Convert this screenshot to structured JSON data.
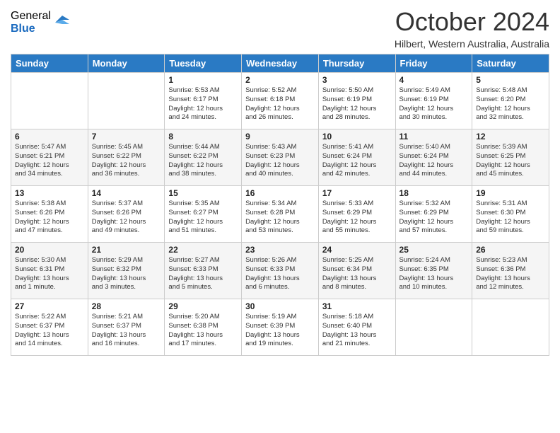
{
  "logo": {
    "general": "General",
    "blue": "Blue"
  },
  "title": "October 2024",
  "location": "Hilbert, Western Australia, Australia",
  "days_header": [
    "Sunday",
    "Monday",
    "Tuesday",
    "Wednesday",
    "Thursday",
    "Friday",
    "Saturday"
  ],
  "weeks": [
    [
      {
        "day": "",
        "info": ""
      },
      {
        "day": "",
        "info": ""
      },
      {
        "day": "1",
        "info": "Sunrise: 5:53 AM\nSunset: 6:17 PM\nDaylight: 12 hours\nand 24 minutes."
      },
      {
        "day": "2",
        "info": "Sunrise: 5:52 AM\nSunset: 6:18 PM\nDaylight: 12 hours\nand 26 minutes."
      },
      {
        "day": "3",
        "info": "Sunrise: 5:50 AM\nSunset: 6:19 PM\nDaylight: 12 hours\nand 28 minutes."
      },
      {
        "day": "4",
        "info": "Sunrise: 5:49 AM\nSunset: 6:19 PM\nDaylight: 12 hours\nand 30 minutes."
      },
      {
        "day": "5",
        "info": "Sunrise: 5:48 AM\nSunset: 6:20 PM\nDaylight: 12 hours\nand 32 minutes."
      }
    ],
    [
      {
        "day": "6",
        "info": "Sunrise: 5:47 AM\nSunset: 6:21 PM\nDaylight: 12 hours\nand 34 minutes."
      },
      {
        "day": "7",
        "info": "Sunrise: 5:45 AM\nSunset: 6:22 PM\nDaylight: 12 hours\nand 36 minutes."
      },
      {
        "day": "8",
        "info": "Sunrise: 5:44 AM\nSunset: 6:22 PM\nDaylight: 12 hours\nand 38 minutes."
      },
      {
        "day": "9",
        "info": "Sunrise: 5:43 AM\nSunset: 6:23 PM\nDaylight: 12 hours\nand 40 minutes."
      },
      {
        "day": "10",
        "info": "Sunrise: 5:41 AM\nSunset: 6:24 PM\nDaylight: 12 hours\nand 42 minutes."
      },
      {
        "day": "11",
        "info": "Sunrise: 5:40 AM\nSunset: 6:24 PM\nDaylight: 12 hours\nand 44 minutes."
      },
      {
        "day": "12",
        "info": "Sunrise: 5:39 AM\nSunset: 6:25 PM\nDaylight: 12 hours\nand 45 minutes."
      }
    ],
    [
      {
        "day": "13",
        "info": "Sunrise: 5:38 AM\nSunset: 6:26 PM\nDaylight: 12 hours\nand 47 minutes."
      },
      {
        "day": "14",
        "info": "Sunrise: 5:37 AM\nSunset: 6:26 PM\nDaylight: 12 hours\nand 49 minutes."
      },
      {
        "day": "15",
        "info": "Sunrise: 5:35 AM\nSunset: 6:27 PM\nDaylight: 12 hours\nand 51 minutes."
      },
      {
        "day": "16",
        "info": "Sunrise: 5:34 AM\nSunset: 6:28 PM\nDaylight: 12 hours\nand 53 minutes."
      },
      {
        "day": "17",
        "info": "Sunrise: 5:33 AM\nSunset: 6:29 PM\nDaylight: 12 hours\nand 55 minutes."
      },
      {
        "day": "18",
        "info": "Sunrise: 5:32 AM\nSunset: 6:29 PM\nDaylight: 12 hours\nand 57 minutes."
      },
      {
        "day": "19",
        "info": "Sunrise: 5:31 AM\nSunset: 6:30 PM\nDaylight: 12 hours\nand 59 minutes."
      }
    ],
    [
      {
        "day": "20",
        "info": "Sunrise: 5:30 AM\nSunset: 6:31 PM\nDaylight: 13 hours\nand 1 minute."
      },
      {
        "day": "21",
        "info": "Sunrise: 5:29 AM\nSunset: 6:32 PM\nDaylight: 13 hours\nand 3 minutes."
      },
      {
        "day": "22",
        "info": "Sunrise: 5:27 AM\nSunset: 6:33 PM\nDaylight: 13 hours\nand 5 minutes."
      },
      {
        "day": "23",
        "info": "Sunrise: 5:26 AM\nSunset: 6:33 PM\nDaylight: 13 hours\nand 6 minutes."
      },
      {
        "day": "24",
        "info": "Sunrise: 5:25 AM\nSunset: 6:34 PM\nDaylight: 13 hours\nand 8 minutes."
      },
      {
        "day": "25",
        "info": "Sunrise: 5:24 AM\nSunset: 6:35 PM\nDaylight: 13 hours\nand 10 minutes."
      },
      {
        "day": "26",
        "info": "Sunrise: 5:23 AM\nSunset: 6:36 PM\nDaylight: 13 hours\nand 12 minutes."
      }
    ],
    [
      {
        "day": "27",
        "info": "Sunrise: 5:22 AM\nSunset: 6:37 PM\nDaylight: 13 hours\nand 14 minutes."
      },
      {
        "day": "28",
        "info": "Sunrise: 5:21 AM\nSunset: 6:37 PM\nDaylight: 13 hours\nand 16 minutes."
      },
      {
        "day": "29",
        "info": "Sunrise: 5:20 AM\nSunset: 6:38 PM\nDaylight: 13 hours\nand 17 minutes."
      },
      {
        "day": "30",
        "info": "Sunrise: 5:19 AM\nSunset: 6:39 PM\nDaylight: 13 hours\nand 19 minutes."
      },
      {
        "day": "31",
        "info": "Sunrise: 5:18 AM\nSunset: 6:40 PM\nDaylight: 13 hours\nand 21 minutes."
      },
      {
        "day": "",
        "info": ""
      },
      {
        "day": "",
        "info": ""
      }
    ]
  ]
}
